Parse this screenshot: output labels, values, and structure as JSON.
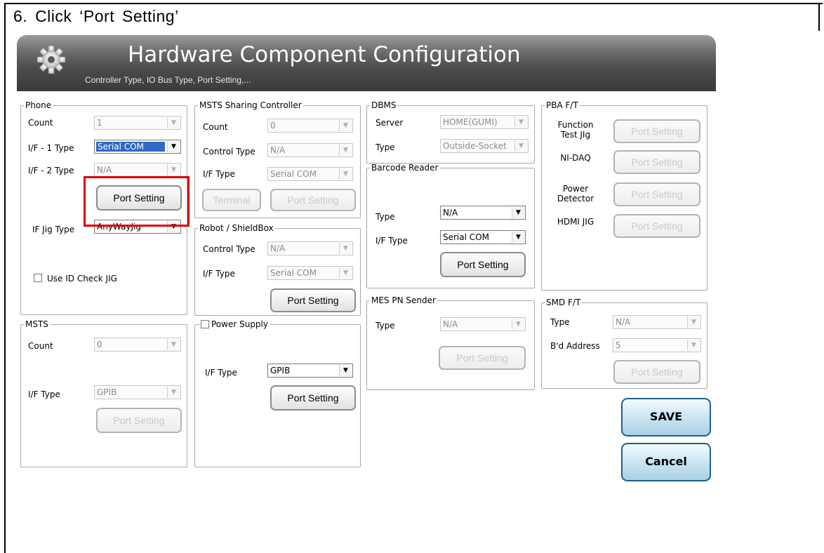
{
  "step_text": "6.  Click  ‘Port  Setting’",
  "header": {
    "title": "Hardware Component Configuration",
    "subtitle": "Controller Type, IO Bus Type, Port Setting,..."
  },
  "phone": {
    "legend": "Phone",
    "count_label": "Count",
    "count_value": "1",
    "if1_label": "I/F - 1 Type",
    "if1_value": "Serial COM",
    "if2_label": "I/F - 2 Type",
    "if2_value": "N/A",
    "port_setting": "Port Setting",
    "jig_label": "IF Jig Type",
    "jig_value": "AnyWayJig",
    "use_id_check": "Use ID Check JIG"
  },
  "msts": {
    "legend": "MSTS",
    "count_label": "Count",
    "count_value": "0",
    "if_label": "I/F Type",
    "if_value": "GPIB",
    "port_setting": "Port Setting"
  },
  "msts_sharing": {
    "legend": "MSTS Sharing Controller",
    "count_label": "Count",
    "count_value": "0",
    "control_label": "Control Type",
    "control_value": "N/A",
    "if_label": "I/F Type",
    "if_value": "Serial COM",
    "terminal": "Terminal",
    "port_setting": "Port Setting"
  },
  "robot": {
    "legend": "Robot / ShieldBox",
    "control_label": "Control Type",
    "control_value": "N/A",
    "if_label": "I/F Type",
    "if_value": "Serial COM",
    "port_setting": "Port Setting"
  },
  "power_supply": {
    "legend": "Power Supply",
    "if_label": "I/F Type",
    "if_value": "GPIB",
    "port_setting": "Port Setting"
  },
  "dbms": {
    "legend": "DBMS",
    "server_label": "Server",
    "server_value": "HOME(GUMI)",
    "type_label": "Type",
    "type_value": "Outside-Socket"
  },
  "barcode": {
    "legend": "Barcode Reader",
    "type_label": "Type",
    "type_value": "N/A",
    "if_label": "I/F Type",
    "if_value": "Serial COM",
    "port_setting": "Port Setting"
  },
  "mes": {
    "legend": "MES PN Sender",
    "type_label": "Type",
    "type_value": "N/A",
    "port_setting": "Port Setting"
  },
  "pba": {
    "legend": "PBA F/T",
    "function_label_1": "Function",
    "function_label_2": "Test JIg",
    "nidaq_label": "NI-DAQ",
    "power_label_1": "Power",
    "power_label_2": "Detector",
    "hdmi_label": "HDMI JIG",
    "port_setting": "Port Setting"
  },
  "smd": {
    "legend": "SMD F/T",
    "type_label": "Type",
    "type_value": "N/A",
    "addr_label": "B'd Address",
    "addr_value": "5",
    "port_setting": "Port Setting"
  },
  "actions": {
    "save": "SAVE",
    "cancel": "Cancel"
  },
  "icons": {
    "gear": "gear-icon",
    "dropdown": "chevron-down-icon"
  },
  "colors": {
    "highlight": "#e00000",
    "selection": "#316ac5"
  }
}
